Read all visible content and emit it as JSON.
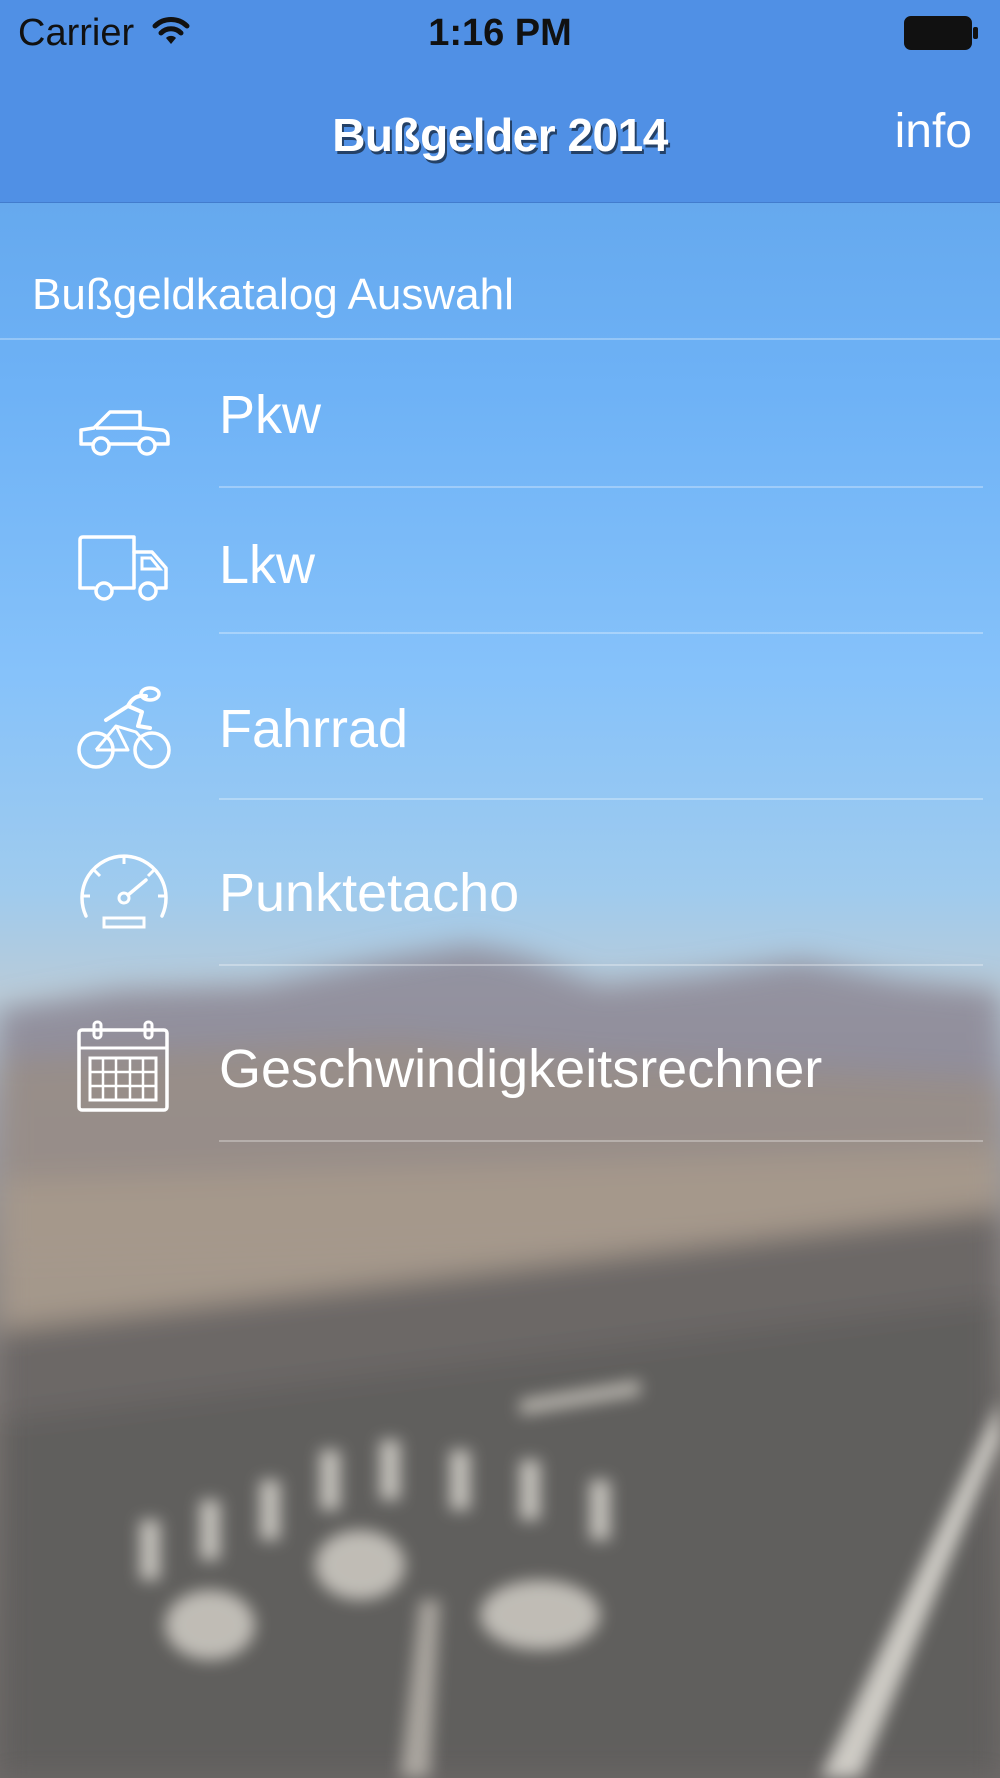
{
  "status_bar": {
    "carrier": "Carrier",
    "time": "1:16 PM"
  },
  "nav": {
    "title": "Bußgelder 2014",
    "info_label": "info"
  },
  "section": {
    "header": "Bußgeldkatalog Auswahl"
  },
  "menu": {
    "items": [
      {
        "label": "Pkw",
        "icon": "car-icon"
      },
      {
        "label": "Lkw",
        "icon": "truck-icon"
      },
      {
        "label": "Fahrrad",
        "icon": "bicycle-icon"
      },
      {
        "label": "Punktetacho",
        "icon": "speedometer-icon"
      },
      {
        "label": "Geschwindigkeitsrechner",
        "icon": "calendar-icon"
      }
    ]
  },
  "colors": {
    "nav_bar": "#508fe4",
    "text": "#ffffff"
  }
}
